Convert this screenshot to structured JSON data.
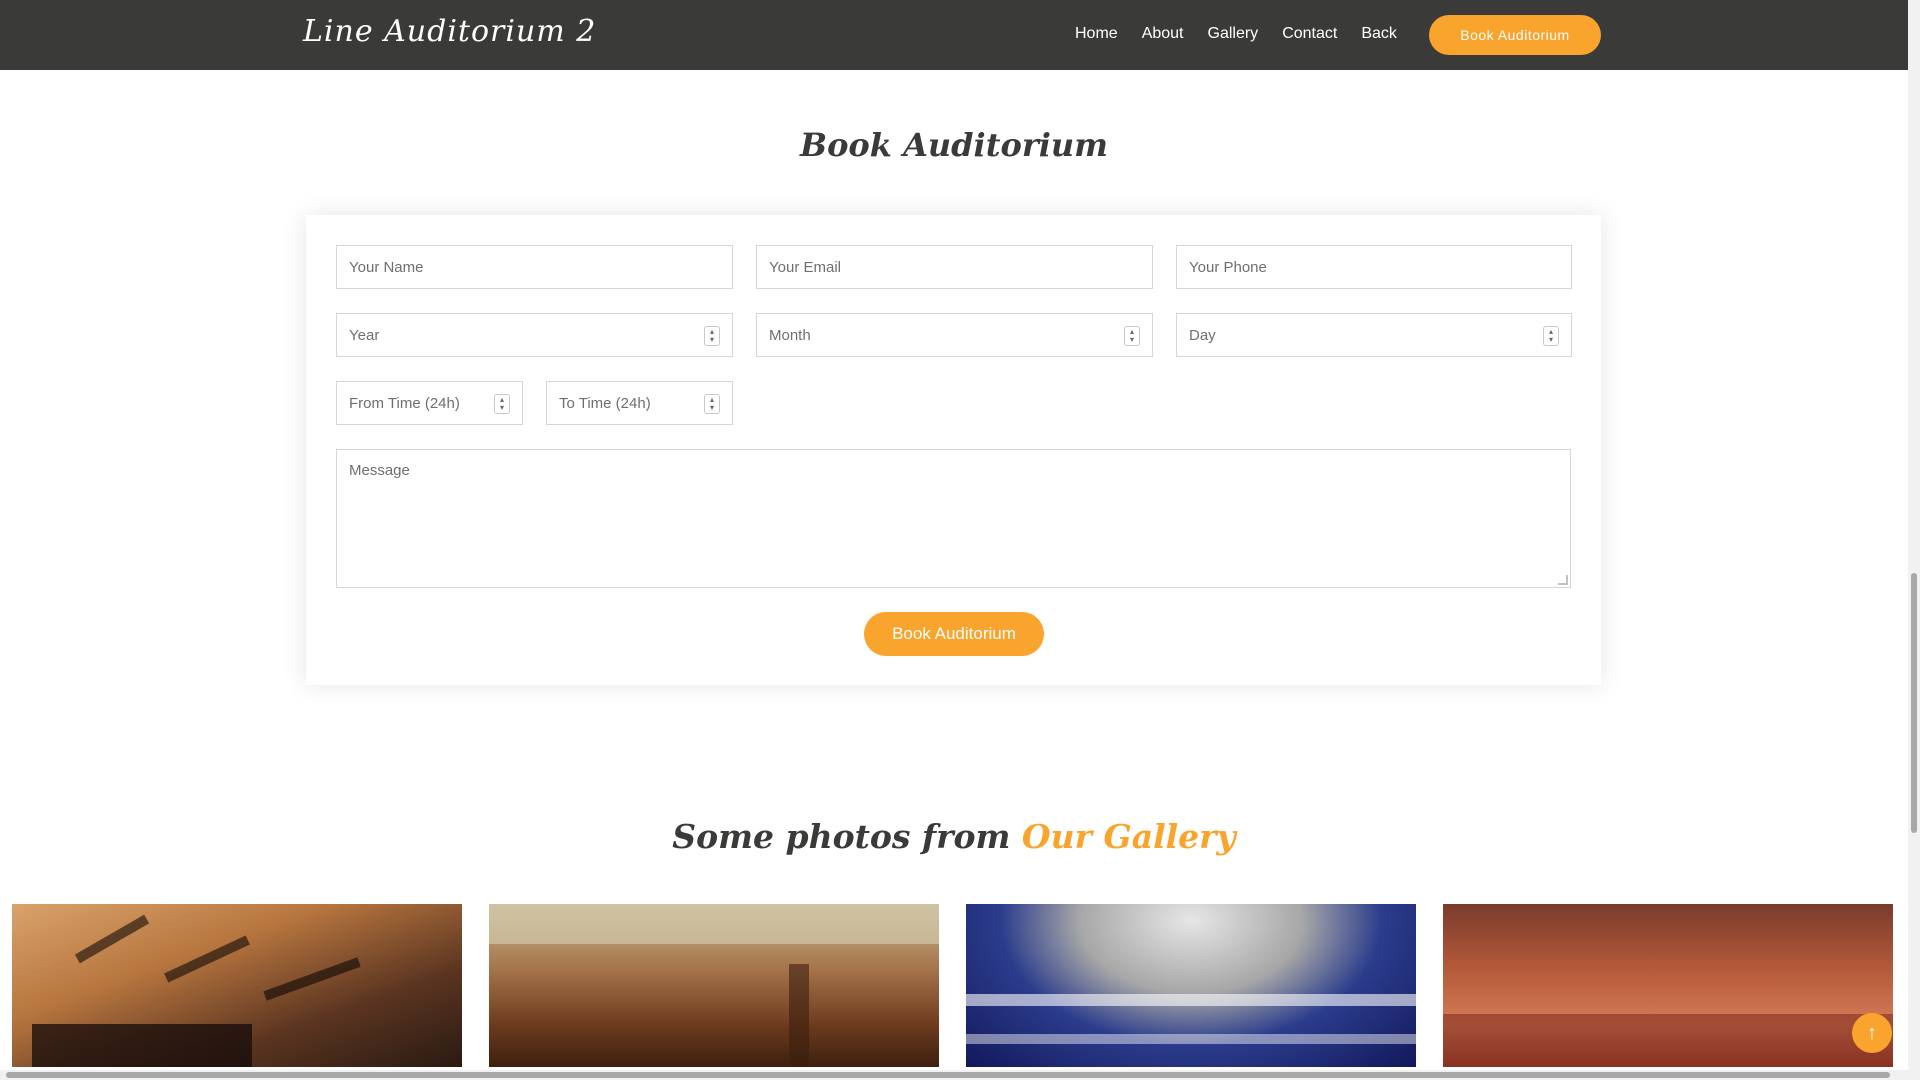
{
  "navbar": {
    "brand": "Line Auditorium 2",
    "links": [
      "Home",
      "About",
      "Gallery",
      "Contact",
      "Back"
    ],
    "cta_label": "Book Auditorium"
  },
  "booking": {
    "title": "Book Auditorium",
    "name_placeholder": "Your Name",
    "email_placeholder": "Your Email",
    "phone_placeholder": "Your Phone",
    "year_placeholder": "Year",
    "month_placeholder": "Month",
    "day_placeholder": "Day",
    "from_time_placeholder": "From Time (24h)",
    "to_time_placeholder": "To Time (24h)",
    "message_placeholder": "Message",
    "submit_label": "Book Auditorium"
  },
  "gallery": {
    "title_prefix": "Some photos from",
    "title_accent": "Our Gallery"
  },
  "icons": {
    "back_to_top": "arrow-up-icon",
    "spinner": "spinner-arrows-icon"
  },
  "colors": {
    "accent": "#f9a42c",
    "navbar_bg": "#3a3a39"
  }
}
